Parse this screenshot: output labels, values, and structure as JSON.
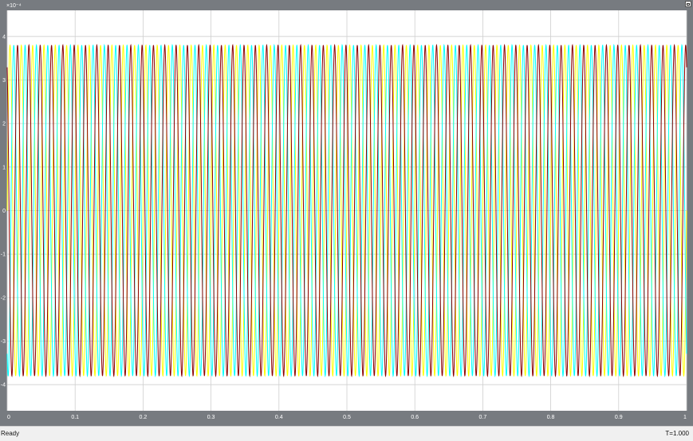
{
  "scope": {
    "exponent_label": "×10⁻⁴",
    "restore_icon": "restore-window-icon"
  },
  "status": {
    "text": "Ready",
    "time": "T=1.000"
  },
  "colors": {
    "window": "#777b80",
    "plot_background": "#ffffff",
    "grid": "#cfcfcf",
    "series": [
      "#ffff00",
      "#00ffff",
      "#8b0000"
    ]
  },
  "chart_data": {
    "type": "line",
    "title": "",
    "xlabel": "",
    "ylabel": "",
    "y_multiplier": "10^-4",
    "xlim": [
      0,
      1
    ],
    "ylim": [
      -4.6,
      4.6
    ],
    "grid": true,
    "x_ticks": [
      0,
      0.1,
      0.2,
      0.3,
      0.4,
      0.5,
      0.6,
      0.7,
      0.8,
      0.9,
      1
    ],
    "x_tick_labels": [
      "0",
      "0.1",
      "0.2",
      "0.3",
      "0.4",
      "0.5",
      "0.6",
      "0.7",
      "0.8",
      "0.9",
      "1"
    ],
    "y_ticks": [
      -4,
      -3,
      -2,
      -1,
      0,
      1,
      2,
      3,
      4
    ],
    "y_tick_labels": [
      "-4",
      "-3",
      "-2",
      "-1",
      "0",
      "1",
      "2",
      "3",
      "4"
    ],
    "series": [
      {
        "color": "#ffff00",
        "amplitude": 3.8,
        "frequency_hz": 60,
        "phase_deg": 0
      },
      {
        "color": "#00ffff",
        "amplitude": 3.8,
        "frequency_hz": 60,
        "phase_deg": -120
      },
      {
        "color": "#8b0000",
        "amplitude": 3.8,
        "frequency_hz": 60,
        "phase_deg": 120
      }
    ]
  }
}
